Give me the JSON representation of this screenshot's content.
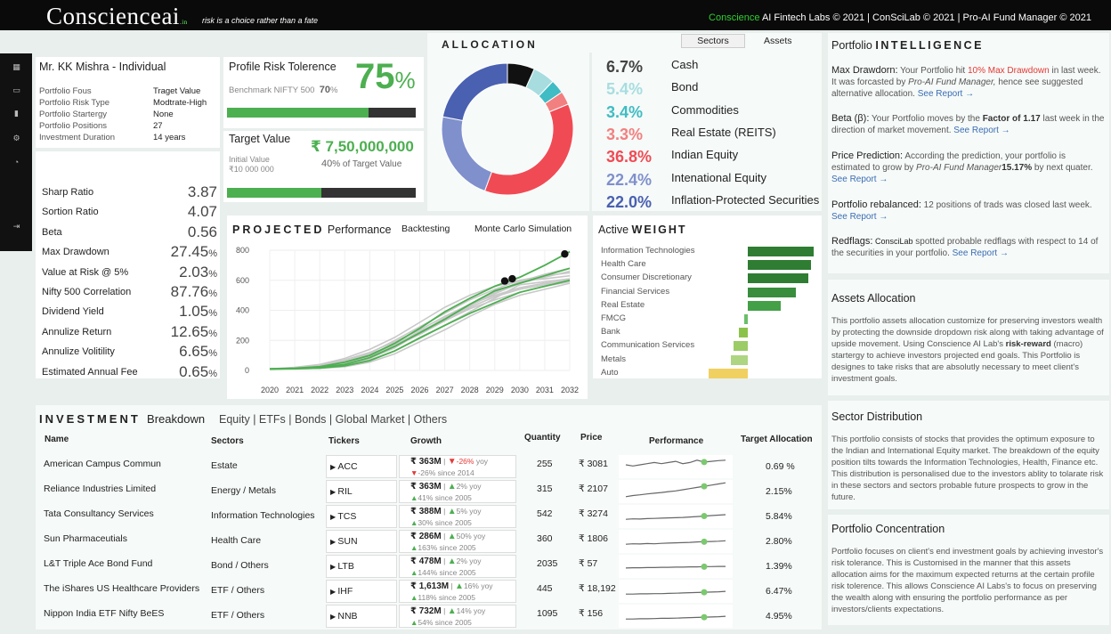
{
  "header": {
    "logo_main": "Conscienceai",
    "logo_suffix": ".in",
    "tagline": "risk is a choice rather than a fate",
    "credit_green": "Conscience",
    "credit_rest": " AI Fintech Labs © 2021  |  ConSciLab © 2021  |  Pro-AI Fund Manager © 2021"
  },
  "profile": {
    "name": "Mr. KK Mishra  -  Individual",
    "fields": [
      {
        "label": "Portfolio Fous",
        "value": "Traget Value"
      },
      {
        "label": "Portfolio Risk Type",
        "value": "Modtrate-High"
      },
      {
        "label": "Portfolio Startergy",
        "value": "None"
      },
      {
        "label": "Portfolio Positions",
        "value": "27"
      },
      {
        "label": "Investment Duration",
        "value": "14 years"
      }
    ]
  },
  "risk": {
    "title": "Profile Risk Tolerence",
    "value": "75",
    "unit": "%",
    "benchmark_label": "Benchmark NIFTY 500",
    "benchmark_value": "70",
    "benchmark_unit": "%",
    "fill_fraction": 0.75
  },
  "target": {
    "title": "Target Value",
    "value": "₹ 7,50,000,000",
    "initial_label": "Initial Value",
    "initial_value": "₹10 000 000",
    "pct": "40",
    "pct_text": "% of Target Value",
    "fill_fraction": 0.5
  },
  "metrics": [
    {
      "label": "Sharp Ratio",
      "value": "3.87",
      "unit": ""
    },
    {
      "label": "Sortion Ratio",
      "value": "4.07",
      "unit": ""
    },
    {
      "label": "Beta",
      "value": "0.56",
      "unit": ""
    },
    {
      "label": "Max Drawdown",
      "value": "27.45",
      "unit": "%"
    },
    {
      "label": "Value at Risk @ 5%",
      "value": "2.03",
      "unit": "%"
    },
    {
      "label": "Nifty 500 Correlation",
      "value": "87.76",
      "unit": "%"
    },
    {
      "label": "Dividend Yield",
      "value": "1.05",
      "unit": "%"
    },
    {
      "label": "Annulize Return",
      "value": "12.65",
      "unit": "%"
    },
    {
      "label": "Annulize Volitility",
      "value": "6.65",
      "unit": "%"
    },
    {
      "label": "Estimated Annual Fee",
      "value": "0.65",
      "unit": "%"
    }
  ],
  "allocation": {
    "title": "ALLOCATION",
    "tab_sectors": "Sectors",
    "tab_assets": "Assets",
    "items": [
      {
        "pct": "6.7%",
        "label": "Cash",
        "color": "#111111",
        "value": 6.7
      },
      {
        "pct": "5.4%",
        "label": "Bond",
        "color": "#a8dde0",
        "value": 5.4
      },
      {
        "pct": "3.4%",
        "label": "Commodities",
        "color": "#3fbcc4",
        "value": 3.4
      },
      {
        "pct": "3.3%",
        "label": "Real Estate (REITS)",
        "color": "#f28080",
        "value": 3.3
      },
      {
        "pct": "36.8%",
        "label": "Indian Equity",
        "color": "#f04b55",
        "value": 36.8
      },
      {
        "pct": "22.4%",
        "label": "Intenational Equity",
        "color": "#8090cc",
        "value": 22.4
      },
      {
        "pct": "22.0%",
        "label": "Inflation-Protected Securities",
        "color": "#4a60b0",
        "value": 22.0
      }
    ]
  },
  "projected": {
    "title_bold": "PROJECTED",
    "title_rest": " Performance",
    "tab1": "Backtesting",
    "tab2": "Monte Carlo Simulation"
  },
  "active_weight": {
    "title_a": "Active ",
    "title_b": "WEIGHT"
  },
  "chart_data": [
    {
      "type": "line",
      "x": [
        2020,
        2021,
        2022,
        2023,
        2024,
        2025,
        2026,
        2027,
        2028,
        2029,
        2030,
        2031,
        2032
      ],
      "ylim": [
        0,
        800
      ],
      "yticks": [
        0,
        200,
        400,
        600,
        800
      ],
      "grid": true,
      "series": [
        {
          "values": [
            10,
            15,
            25,
            55,
            100,
            180,
            280,
            390,
            480,
            560,
            620,
            700,
            790
          ]
        },
        {
          "values": [
            10,
            12,
            18,
            35,
            80,
            150,
            250,
            350,
            430,
            520,
            590,
            640,
            680
          ]
        },
        {
          "values": [
            10,
            10,
            15,
            30,
            70,
            130,
            220,
            300,
            390,
            480,
            570,
            590,
            610
          ]
        },
        {
          "values": [
            10,
            20,
            40,
            80,
            140,
            220,
            320,
            420,
            500,
            560,
            600,
            610,
            630
          ]
        },
        {
          "values": [
            10,
            11,
            14,
            25,
            55,
            110,
            190,
            270,
            360,
            440,
            500,
            540,
            580
          ]
        },
        {
          "values": [
            10,
            18,
            35,
            70,
            120,
            190,
            270,
            360,
            440,
            500,
            550,
            580,
            600
          ]
        },
        {
          "values": [
            10,
            12,
            20,
            45,
            90,
            160,
            240,
            330,
            410,
            470,
            520,
            560,
            590
          ]
        },
        {
          "values": [
            10,
            14,
            26,
            60,
            110,
            170,
            260,
            340,
            430,
            510,
            580,
            620,
            660
          ]
        },
        {
          "values": [
            10,
            16,
            30,
            65,
            115,
            200,
            290,
            380,
            470,
            540,
            600,
            630,
            650
          ]
        },
        {
          "values": [
            10,
            13,
            22,
            50,
            95,
            165,
            250,
            330,
            420,
            490,
            540,
            570,
            610
          ]
        }
      ],
      "highlight_series": [
        {
          "values": [
            10,
            15,
            25,
            55,
            100,
            180,
            280,
            390,
            480,
            560,
            620,
            700,
            790
          ]
        },
        {
          "values": [
            10,
            12,
            20,
            40,
            85,
            160,
            250,
            340,
            440,
            530,
            580,
            630,
            680
          ]
        },
        {
          "values": [
            10,
            11,
            16,
            30,
            65,
            130,
            215,
            300,
            380,
            450,
            520,
            560,
            600
          ]
        }
      ],
      "markers": [
        {
          "x": 2031.8,
          "y": 775
        },
        {
          "x": 2029.4,
          "y": 595
        },
        {
          "x": 2029.7,
          "y": 610
        }
      ]
    },
    {
      "type": "bar",
      "orientation": "horizontal",
      "categories": [
        "Information Technologies",
        "Health Care",
        "Consumer Discretionary",
        "Financial Services",
        "Real Estate",
        "FMCG",
        "Bank",
        "Communication Services",
        "Metals",
        "Auto"
      ],
      "values": [
        6.2,
        5.9,
        5.7,
        4.5,
        3.1,
        -0.3,
        -0.8,
        -1.3,
        -1.6,
        -3.7
      ],
      "colors": [
        "#2e7d32",
        "#2e7d32",
        "#2e7d32",
        "#388e3c",
        "#43a047",
        "#6abf69",
        "#8bc34a",
        "#9ccc65",
        "#aed581",
        "#f0d060"
      ]
    }
  ],
  "intelligence": {
    "title_a": "Portfolio ",
    "title_b": "INTELLIGENCE",
    "see_report": "See Report →",
    "items": [
      {
        "head": "Max Drawdorn:",
        "t1": " Your Portfolio hit ",
        "red": "10% Max Drawdown",
        "t2": " in last week. It was forcasted by ",
        "ital": "Pro-AI Fund Manager,",
        "t3": " hence see suggested alternative allocation."
      },
      {
        "head": "Beta (β):",
        "t1": " Your Portfolio moves by the ",
        "bold": "Factor of 1.17",
        "t2": " last week in the direction of market movement."
      },
      {
        "head": "Price Prediction:",
        "t1": " According the ",
        "ital": "Pro-AI Fund Manager",
        "t2": " prediction, your portfolio is estimated to grow by ",
        "bold": "15.17%",
        "t3": " by next quater."
      },
      {
        "head": "Portfolio rebalanced:",
        "t1": " 12 positions of trads was closed last week."
      },
      {
        "head": "Redflags:",
        "small": " ConsciLab",
        "t1": " spotted probable redflags with respect to 14 of the securities in your portfolio."
      }
    ]
  },
  "assets_alloc": {
    "title": "Assets Allocation",
    "t1": "This portfolio assets allocation customize for preserving investors wealth by protecting the downside dropdown risk along with taking advantage of upside movement. Using Conscience AI Lab's ",
    "bold": "risk-reward",
    "t2": " (macro) startergy to achieve investors projected end goals. This Portfolio is designes to take risks that are absolutly necessary to meet client's investment goals."
  },
  "sector_dist": {
    "title": "Sector Distribution",
    "text": "This portfolio consists of stocks that provides the optimum exposure to the Indian and International Equity market. The breakdown of the equity position tilts towards the Information Technologies, Health, Finance etc. This distribution is personalised due to the investors ablity to tolarate risk in these sectors and sectors probable future prospects to grow in the future."
  },
  "concentration": {
    "title": "Portfolio Concentration",
    "text": "Portfolio focuses on client's end investment goals by achieving investor's risk tolerance. This is Customised in the manner that this assets allocation aims for the maximum expected returns at the certain profile risk tolerence. This allows Conscience AI Labs's to focus on preserving the wealth along with ensuring the portfolio performance as per investors/clients expectations."
  },
  "investment": {
    "title_bold": "INVESTMENT",
    "title_rest": "Breakdown",
    "filters": "Equity |  ETFs | Bonds | Global Market | Others",
    "columns": {
      "name": "Name",
      "sector": "Sectors",
      "ticker": "Tickers",
      "growth": "Growth",
      "qty": "Quantity",
      "price": "Price",
      "perf": "Performance",
      "target": "Target Allocation"
    },
    "rows": [
      {
        "name": "American Campus Commun",
        "sector": "Estate",
        "ticker": "ACC",
        "g1": "₹ 363M",
        "yoy": "-26%",
        "yoy_dir": "down",
        "since": "-26%",
        "since_text": " since 2014",
        "since_dir": "down",
        "qty": "255",
        "price": "₹ 3081",
        "target": "0.69 %",
        "perf": [
          0.5,
          0.45,
          0.5,
          0.55,
          0.6,
          0.55,
          0.6,
          0.65,
          0.55,
          0.6,
          0.7,
          0.62,
          0.65,
          0.68,
          0.7
        ]
      },
      {
        "name": "Reliance Industries Limited",
        "sector": "Energy / Metals",
        "ticker": "RIL",
        "g1": "₹ 363M",
        "yoy": "2%",
        "yoy_dir": "up",
        "since": "41%",
        "since_text": " since 2005",
        "since_dir": "up",
        "qty": "315",
        "price": "₹ 2107",
        "target": "2.15%",
        "perf": [
          0.2,
          0.25,
          0.28,
          0.32,
          0.35,
          0.38,
          0.42,
          0.45,
          0.5,
          0.55,
          0.6,
          0.65,
          0.7,
          0.75,
          0.8
        ]
      },
      {
        "name": "Tata Consultancy Services",
        "sector": "Information Technologies",
        "ticker": "TCS",
        "g1": "₹ 388M",
        "yoy": "5%",
        "yoy_dir": "up",
        "since": "30%",
        "since_text": " since 2005",
        "since_dir": "up",
        "qty": "542",
        "price": "₹ 3274",
        "target": "5.84%",
        "perf": [
          0.3,
          0.32,
          0.31,
          0.33,
          0.34,
          0.35,
          0.36,
          0.37,
          0.38,
          0.4,
          0.42,
          0.44,
          0.46,
          0.48,
          0.5
        ]
      },
      {
        "name": "Sun Pharmaceutials",
        "sector": "Health Care",
        "ticker": "SUN",
        "g1": "₹ 286M",
        "yoy": "50%",
        "yoy_dir": "up",
        "since": "163%",
        "since_text": " since 2005",
        "since_dir": "up",
        "qty": "360",
        "price": "₹ 1806",
        "target": "2.80%",
        "perf": [
          0.3,
          0.32,
          0.31,
          0.33,
          0.32,
          0.34,
          0.35,
          0.36,
          0.37,
          0.38,
          0.4,
          0.41,
          0.42,
          0.43,
          0.45
        ]
      },
      {
        "name": "L&T Triple Ace Bond Fund",
        "sector": "Bond  / Others",
        "ticker": "LTB",
        "g1": "₹ 478M",
        "yoy": "2%",
        "yoy_dir": "up",
        "since": "144%",
        "since_text": " since 2005",
        "since_dir": "up",
        "qty": "2035",
        "price": "₹ 57",
        "target": "1.39%",
        "perf": [
          0.35,
          0.36,
          0.36,
          0.37,
          0.37,
          0.38,
          0.38,
          0.39,
          0.39,
          0.4,
          0.4,
          0.41,
          0.41,
          0.42,
          0.42
        ]
      },
      {
        "name": "The iShares US Healthcare Providers",
        "sector": "ETF / Others",
        "ticker": "IHF",
        "g1": "₹ 1,613M",
        "yoy": "16%",
        "yoy_dir": "up",
        "since": "118%",
        "since_text": " since 2005",
        "since_dir": "up",
        "qty": "445",
        "price": "₹ 18,192",
        "target": "6.47%",
        "perf": [
          0.3,
          0.3,
          0.31,
          0.31,
          0.32,
          0.32,
          0.33,
          0.34,
          0.35,
          0.36,
          0.37,
          0.38,
          0.39,
          0.4,
          0.42
        ]
      },
      {
        "name": "Nippon India ETF Nifty BeES",
        "sector": "ETF / Others",
        "ticker": "NNB",
        "g1": "₹ 732M",
        "yoy": "14%",
        "yoy_dir": "up",
        "since": "54%",
        "since_text": " since 2005",
        "since_dir": "up",
        "qty": "1095",
        "price": "₹ 156",
        "target": "4.95%",
        "perf": [
          0.3,
          0.3,
          0.31,
          0.31,
          0.32,
          0.33,
          0.33,
          0.34,
          0.35,
          0.36,
          0.37,
          0.38,
          0.39,
          0.4,
          0.42
        ]
      }
    ]
  }
}
